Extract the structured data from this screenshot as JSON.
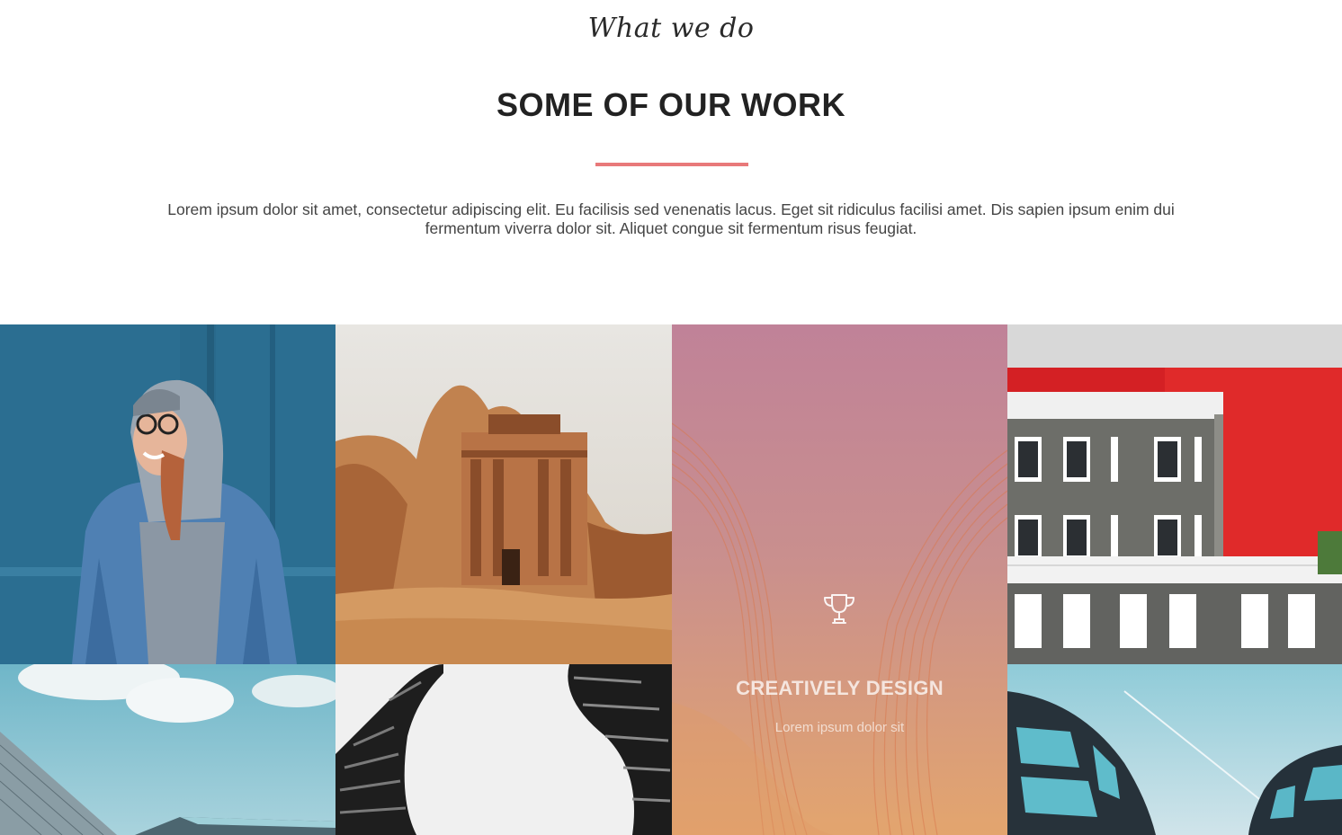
{
  "section": {
    "kicker": "What we do",
    "title": "SOME OF OUR WORK",
    "description": "Lorem ipsum dolor sit amet, consectetur adipiscing elit. Eu facilisis sed venenatis lacus. Eget sit ridiculus facilisi amet. Dis sapien ipsum enim dui fermentum viverra dolor sit. Aliquet congue sit fermentum risus feugiat.",
    "accent_color": "#e8797a"
  },
  "portfolio": {
    "feature": {
      "icon": "trophy-icon",
      "title": "CREATIVELY DESIGN",
      "subtitle": "Lorem ipsum dolor sit"
    }
  }
}
